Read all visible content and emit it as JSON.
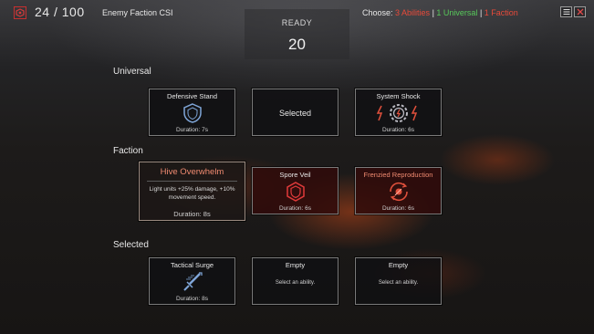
{
  "top": {
    "counter": "24 / 100",
    "enemy_faction": "Enemy Faction CSI",
    "choose_prefix": "Choose: ",
    "choose_abilities": "3 Abilities",
    "choose_sep1": " | ",
    "choose_universal": "1 Universal",
    "choose_sep2": " | ",
    "choose_faction": "1 Faction"
  },
  "ready": {
    "label": "READY",
    "countdown": "20"
  },
  "sections": {
    "universal": "Universal",
    "faction": "Faction",
    "selected": "Selected"
  },
  "universal_cards": [
    {
      "title": "Defensive Stand",
      "duration": "Duration: 7s",
      "icon": "shield-icon"
    },
    {
      "center": "Selected"
    },
    {
      "title": "System Shock",
      "duration": "Duration: 6s",
      "icon": "gear-lightning-icon"
    }
  ],
  "faction_cards": [
    {
      "title": "Hive Overwhelm",
      "description": "Light units +25% damage, +10% movement speed.",
      "duration": "Duration: 8s"
    },
    {
      "title": "Spore Veil",
      "duration": "Duration: 6s",
      "icon": "hex-shield-icon"
    },
    {
      "title": "Frenzied Reproduction",
      "duration": "Duration: 6s",
      "icon": "spawn-icon"
    }
  ],
  "selected_cards": [
    {
      "title": "Tactical Surge",
      "duration": "Duration: 8s",
      "icon": "sword-icon"
    },
    {
      "title": "Empty",
      "hint": "Select an ability."
    },
    {
      "title": "Empty",
      "hint": "Select an ability."
    }
  ],
  "colors": {
    "red": "#e74a3a",
    "green": "#57c95a",
    "salmon": "#f08a70"
  }
}
